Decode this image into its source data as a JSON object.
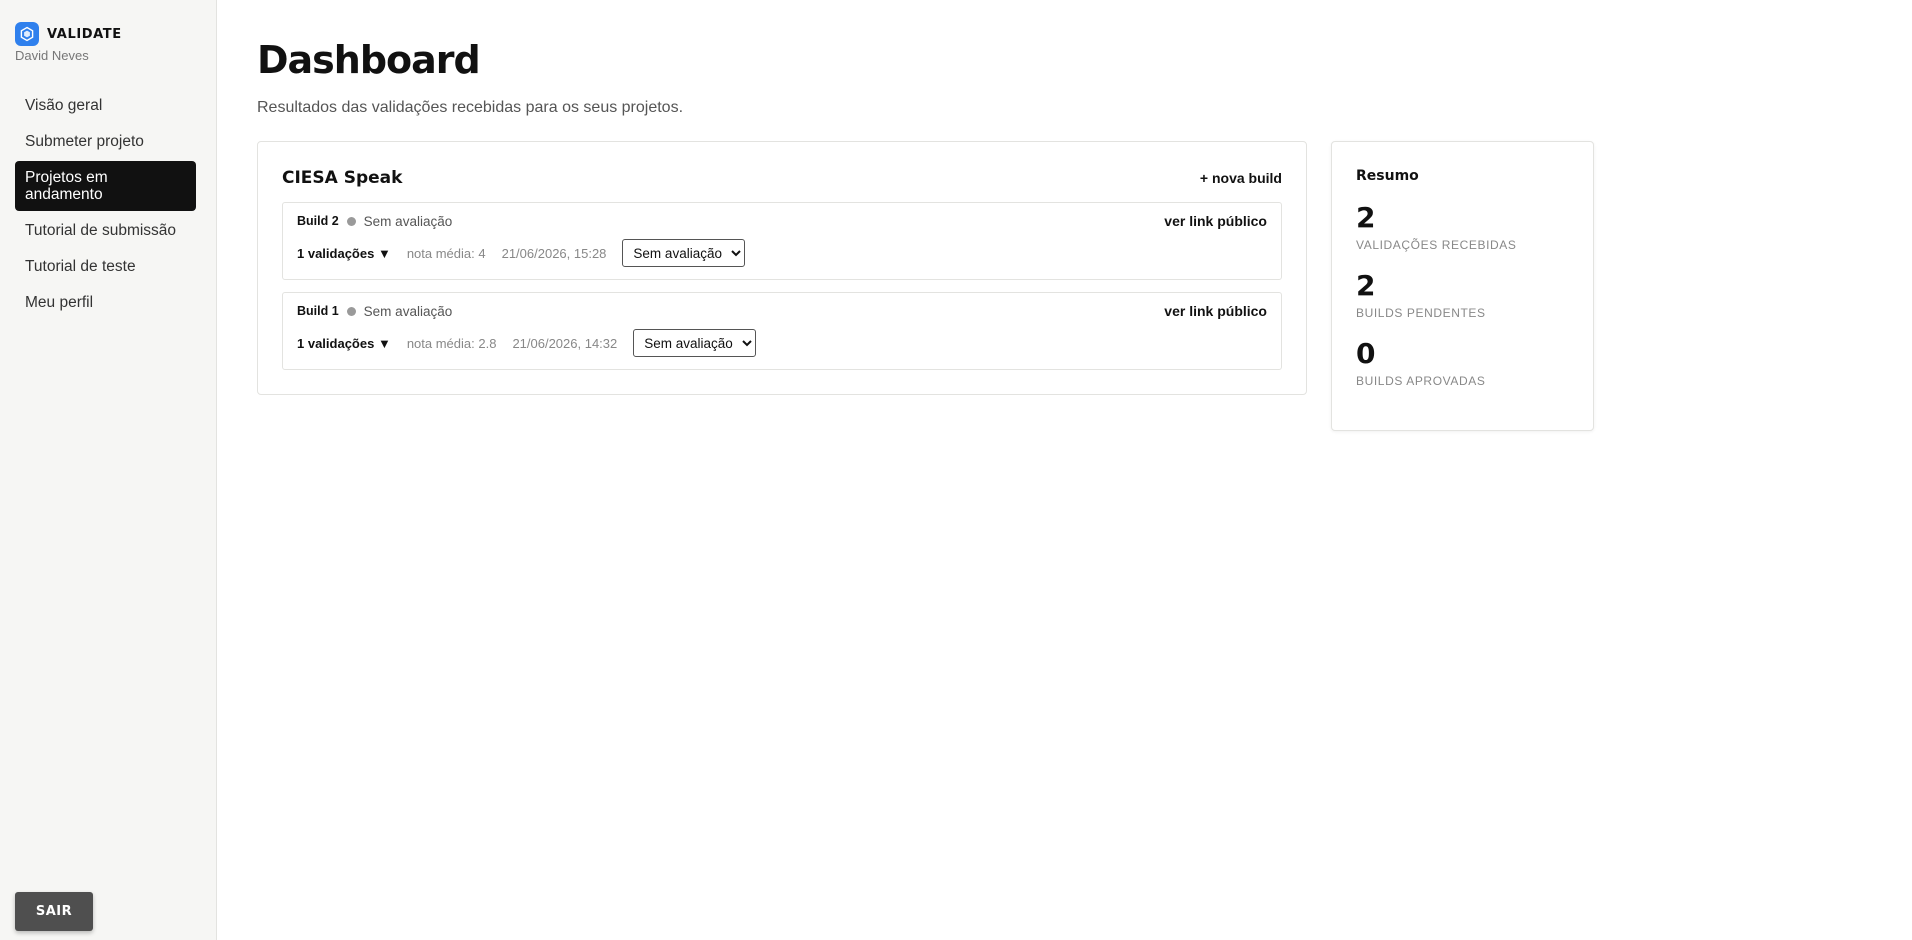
{
  "app": {
    "name": "VALIDATE",
    "user": "David Neves"
  },
  "sidebar": {
    "items": [
      {
        "label": "Visão geral"
      },
      {
        "label": "Submeter projeto"
      },
      {
        "label": "Projetos em andamento",
        "active": true
      },
      {
        "label": "Tutorial de submissão"
      },
      {
        "label": "Tutorial de teste"
      },
      {
        "label": "Meu perfil"
      }
    ],
    "logout_label": "SAIR"
  },
  "page": {
    "title": "Dashboard",
    "subtitle": "Resultados das validações recebidas para os seus projetos."
  },
  "project": {
    "name": "CIESA Speak",
    "new_build_label": "+ nova build",
    "builds": [
      {
        "name": "Build 2",
        "status": "Sem avaliação",
        "public_link_label": "ver link público",
        "validations_label": "1 validações ▼",
        "average": "nota média: 4",
        "date": "21/06/2026, 15:28",
        "select_value": "Sem avaliação"
      },
      {
        "name": "Build 1",
        "status": "Sem avaliação",
        "public_link_label": "ver link público",
        "validations_label": "1 validações ▼",
        "average": "nota média: 2.8",
        "date": "21/06/2026, 14:32",
        "select_value": "Sem avaliação"
      }
    ]
  },
  "summary": {
    "title": "Resumo",
    "stats": [
      {
        "value": "2",
        "label": "VALIDAÇÕES RECEBIDAS"
      },
      {
        "value": "2",
        "label": "BUILDS PENDENTES"
      },
      {
        "value": "0",
        "label": "BUILDS APROVADAS"
      }
    ]
  },
  "colors": {
    "brand_blue": "#2f80ed",
    "active_nav_bg": "#111111",
    "status_dot": "#9a9a9a",
    "logout_bg": "#4f4f4f"
  }
}
